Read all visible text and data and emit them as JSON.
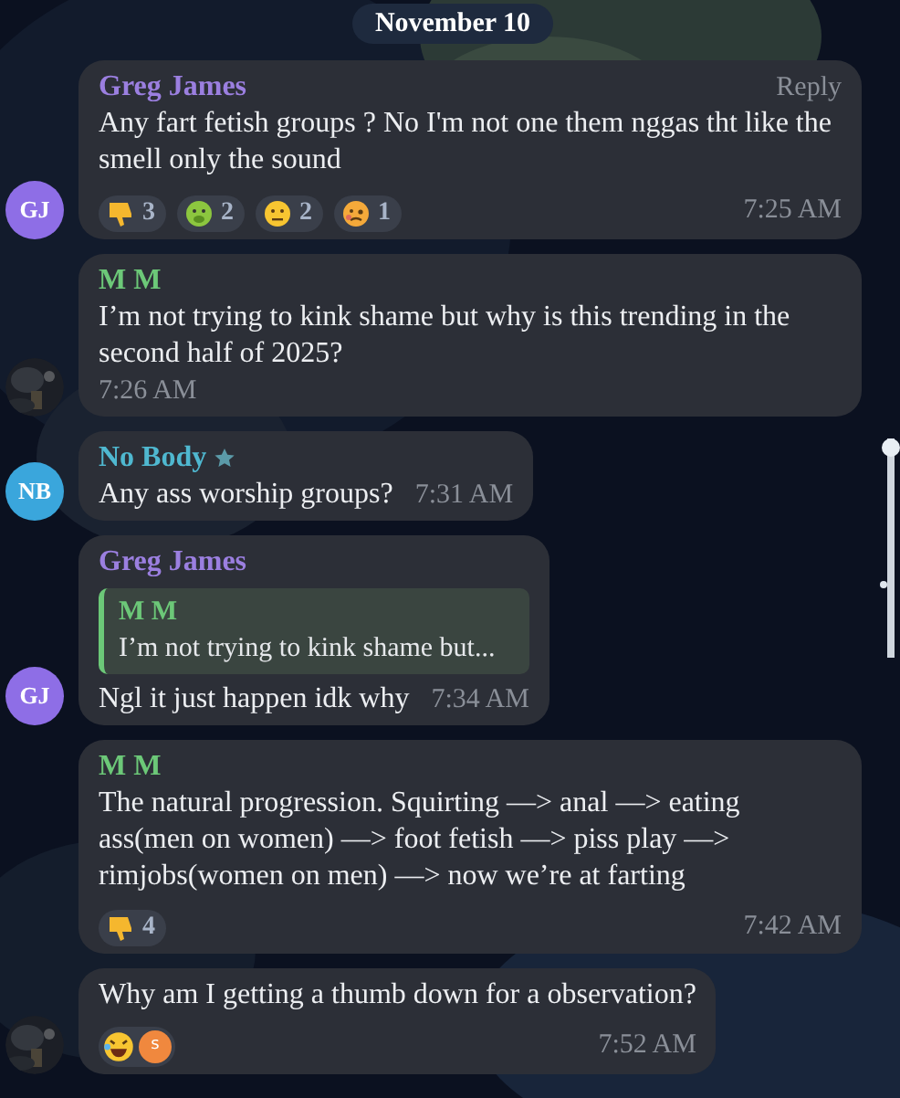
{
  "date": "November 10",
  "messages": [
    {
      "sender": {
        "name": "Greg James",
        "color": "#9b7fe0",
        "starred": false
      },
      "reply_link": "Reply",
      "text": "Any fart fetish groups ? No I'm not one them nggas tht like the smell only the sound",
      "reactions": [
        {
          "kind": "thumbs-down",
          "count": "3"
        },
        {
          "kind": "nauseated",
          "count": "2"
        },
        {
          "kind": "neutral",
          "count": "2"
        },
        {
          "kind": "woozy",
          "count": "1"
        }
      ],
      "time": "7:25 AM",
      "avatar": {
        "kind": "initials",
        "text": "GJ",
        "color": "#8e6ee6"
      }
    },
    {
      "sender": {
        "name": "M M",
        "color": "#6cc878",
        "starred": false
      },
      "text": "I’m not trying to kink shame but why is this trending in the second half of 2025?",
      "time": "7:26 AM"
    },
    {
      "sender": {
        "name": "No Body",
        "color": "#4fb8d0",
        "starred": true
      },
      "text": "Any ass worship groups?",
      "time": "7:31 AM",
      "avatar": {
        "kind": "initials",
        "text": "NB",
        "color": "#3aa6dc"
      }
    },
    {
      "sender": {
        "name": "Greg James",
        "color": "#9b7fe0",
        "starred": false
      },
      "reply_to": {
        "sender": "M M",
        "text": "I’m not trying to kink shame but...",
        "color": "#6cc878"
      },
      "text": "Ngl it just happen idk why",
      "time": "7:34 AM",
      "avatar": {
        "kind": "initials",
        "text": "GJ",
        "color": "#8e6ee6"
      }
    },
    {
      "sender": {
        "name": "M M",
        "color": "#6cc878",
        "starred": false
      },
      "text": "The natural progression. Squirting —> anal —> eating ass(men on women) —> foot fetish —> piss play —> rimjobs(women on men) —> now we’re at farting",
      "reactions": [
        {
          "kind": "thumbs-down",
          "count": "4"
        }
      ],
      "time": "7:42 AM"
    },
    {
      "text": "Why am I getting a thumb down for a observation?",
      "reactions": [
        {
          "kind": "rofl",
          "reactors": [
            "s"
          ]
        }
      ],
      "time": "7:52 AM"
    }
  ]
}
